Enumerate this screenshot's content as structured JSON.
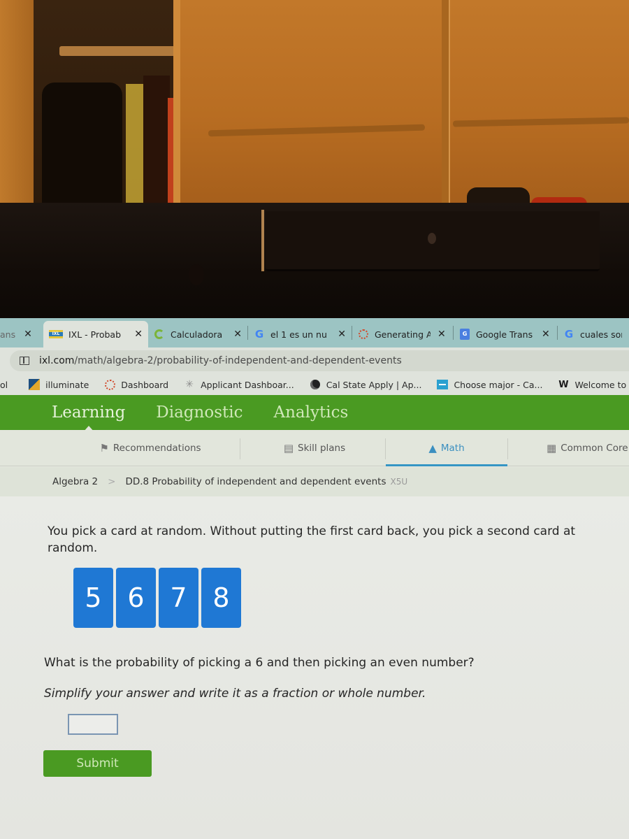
{
  "browser": {
    "tabs": [
      {
        "title": "ans",
        "icon": "tab-partial-icon",
        "close": "✕",
        "active": false
      },
      {
        "title": "IXL - Probab",
        "icon": "ixl-favicon-icon",
        "close": "✕",
        "active": true
      },
      {
        "title": "Calculadora",
        "icon": "calculator-favicon-icon",
        "close": "✕",
        "active": false
      },
      {
        "title": "el 1 es un nu",
        "icon": "google-favicon-icon",
        "close": "✕",
        "active": false
      },
      {
        "title": "Generating A",
        "icon": "ring-favicon-icon",
        "close": "✕",
        "active": false
      },
      {
        "title": "Google Trans",
        "icon": "google-translate-favicon-icon",
        "close": "✕",
        "active": false
      },
      {
        "title": "cuales son l",
        "icon": "google-favicon-icon",
        "close": "",
        "active": false
      }
    ],
    "address_bar": {
      "domain": "ixl.com",
      "path": "/math/algebra-2/probability-of-independent-and-dependent-events"
    },
    "bookmarks": [
      {
        "label": "ol",
        "icon": ""
      },
      {
        "label": "illuminate",
        "icon": "illuminate-icon"
      },
      {
        "label": "Dashboard",
        "icon": "ring-icon"
      },
      {
        "label": "Applicant Dashboar...",
        "icon": "spark-icon"
      },
      {
        "label": "Cal State Apply | Ap...",
        "icon": "globe-icon"
      },
      {
        "label": "Choose major - Ca...",
        "icon": "collegemajor-icon"
      },
      {
        "label": "Welcome to Mr. Ets...",
        "icon": "weebly-icon"
      }
    ]
  },
  "ixl": {
    "main_nav": [
      {
        "label": "Learning",
        "active": true
      },
      {
        "label": "Diagnostic",
        "active": false
      },
      {
        "label": "Analytics",
        "active": false
      }
    ],
    "sub_nav": [
      {
        "label": "Recommendations",
        "icon": "signpost-icon",
        "glyph": "⚑",
        "active": false
      },
      {
        "label": "Skill plans",
        "icon": "skill-plans-icon",
        "glyph": "▤",
        "active": false
      },
      {
        "label": "Math",
        "icon": "pyramid-icon",
        "glyph": "▲",
        "active": true
      },
      {
        "label": "Common Core",
        "icon": "clipboard-icon",
        "glyph": "▦",
        "active": false
      }
    ],
    "breadcrumb": {
      "parent": "Algebra 2",
      "separator": ">",
      "skill": "DD.8 Probability of independent and dependent events",
      "code": "X5U"
    },
    "question": {
      "intro": "You pick a card at random. Without putting the first card back, you pick a second card at random.",
      "cards": [
        "5",
        "6",
        "7",
        "8"
      ],
      "prompt": "What is the probability of picking a 6 and then picking an even number?",
      "instruction": "Simplify your answer and write it as a fraction or whole number.",
      "answer_value": "",
      "submit_label": "Submit"
    },
    "colors": {
      "brand_green": "#4a9a22",
      "card_blue": "#1f78d4",
      "active_tab_blue": "#3596c4"
    }
  }
}
